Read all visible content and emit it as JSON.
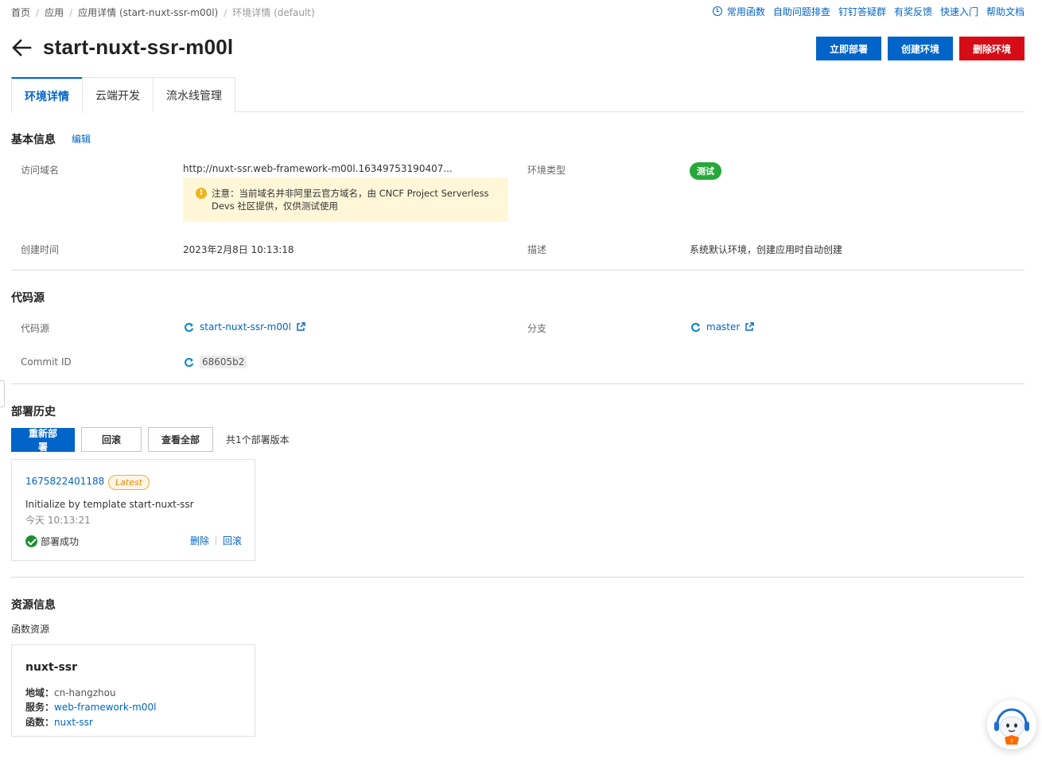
{
  "breadcrumb": {
    "items": [
      "首页",
      "应用",
      "应用详情 (start-nuxt-ssr-m00l)",
      "环境详情 (default)"
    ],
    "separator": "/"
  },
  "helpbar": {
    "links": [
      "常用函数",
      "自助问题排查",
      "钉钉答疑群",
      "有奖反馈",
      "快速入门",
      "帮助文档"
    ]
  },
  "header": {
    "title": "start-nuxt-ssr-m00l",
    "actions": {
      "deploy_now": "立即部署",
      "create_env": "创建环境",
      "delete_env": "删除环境"
    }
  },
  "tabs": [
    "环境详情",
    "云端开发",
    "流水线管理"
  ],
  "basic_info": {
    "title": "基本信息",
    "edit": "编辑",
    "domain_label": "访问域名",
    "domain_value": "http://nuxt-ssr.web-framework-m00l.16349753190407...",
    "notice": "注意：当前域名并非阿里云官方域名，由 CNCF Project Serverless Devs 社区提供，仅供测试使用",
    "env_type_label": "环境类型",
    "env_type_value": "测试",
    "created_label": "创建时间",
    "created_value": "2023年2月8日 10:13:18",
    "desc_label": "描述",
    "desc_value": "系统默认环境，创建应用时自动创建"
  },
  "code_source": {
    "title": "代码源",
    "source_label": "代码源",
    "source_value": "start-nuxt-ssr-m00l",
    "branch_label": "分支",
    "branch_value": "master",
    "commit_label": "Commit ID",
    "commit_value": "68605b2"
  },
  "deploy_history": {
    "title": "部署历史",
    "redeploy": "重新部署",
    "rollback": "回滚",
    "view_all": "查看全部",
    "count_text": "共1个部署版本",
    "card": {
      "version": "1675822401188",
      "badge": "Latest",
      "message": "Initialize by template start-nuxt-ssr",
      "time": "今天 10:13:21",
      "status": "部署成功",
      "delete": "删除",
      "rollback": "回滚"
    }
  },
  "resources": {
    "title": "资源信息",
    "subtitle": "函数资源",
    "card": {
      "name": "nuxt-ssr",
      "region_label": "地域：",
      "region_value": "cn-hangzhou",
      "service_label": "服务：",
      "service_value": "web-framework-m00l",
      "function_label": "函数：",
      "function_value": "nuxt-ssr"
    }
  },
  "colors": {
    "primary": "#0064c8",
    "danger": "#d50b16",
    "success": "#1f8e33",
    "tag_test": "#27a83a",
    "notice_bg": "#fff7d8"
  },
  "icons": [
    "back-arrow-icon",
    "clock-icon",
    "warning-icon",
    "sync-icon",
    "external-link-icon",
    "success-check-icon",
    "assistant-avatar-icon"
  ]
}
